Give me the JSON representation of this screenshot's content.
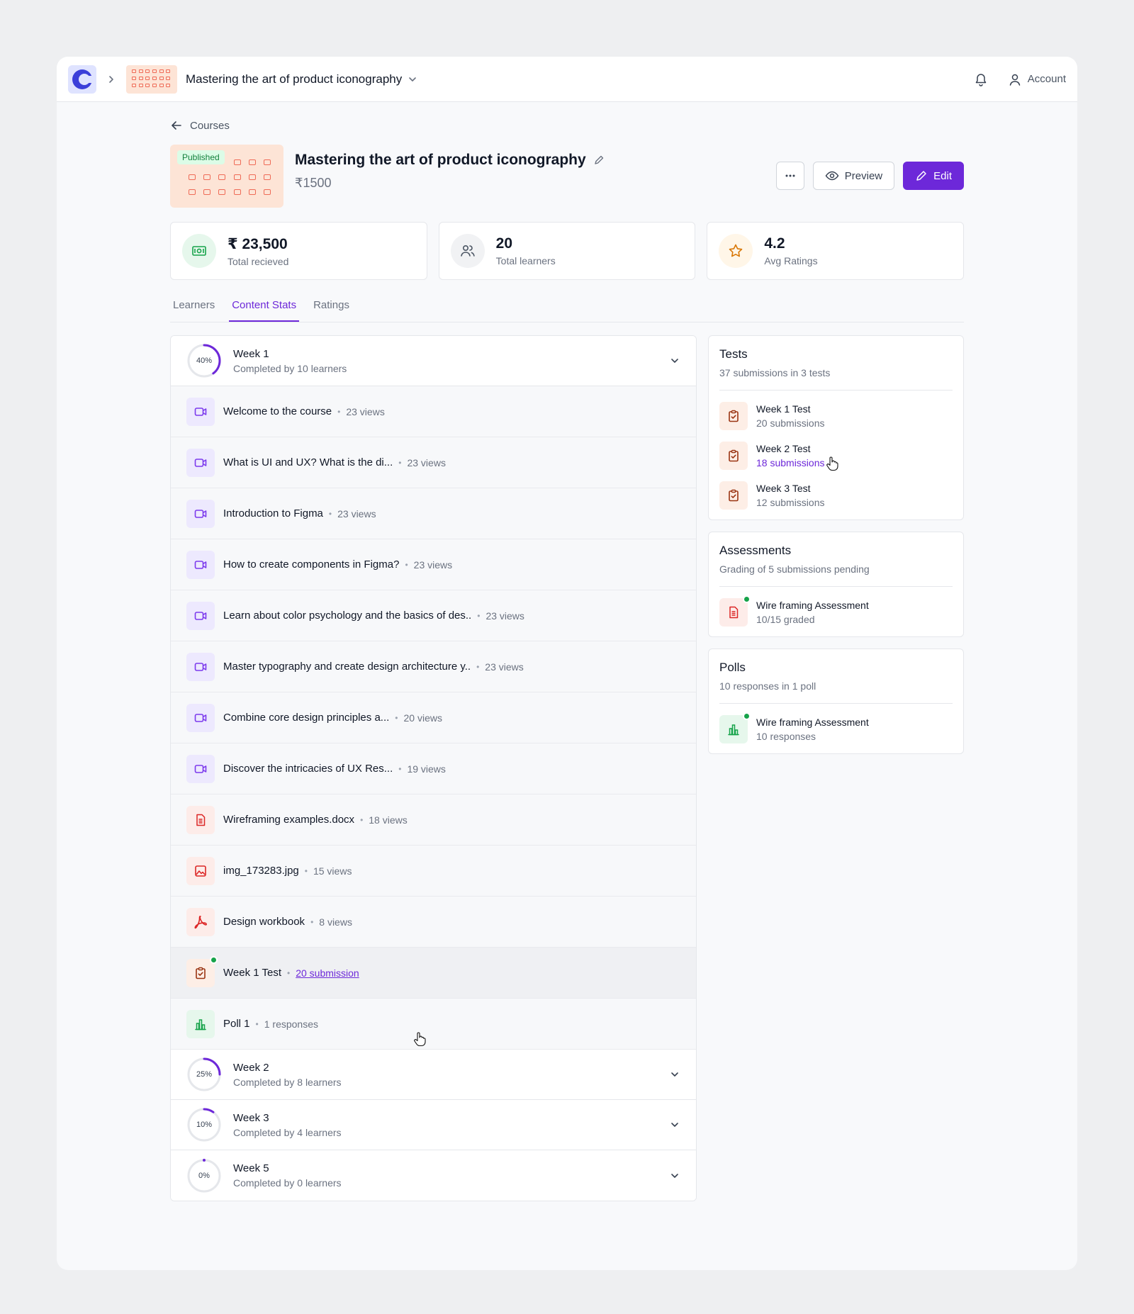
{
  "topbar": {
    "course_title": "Mastering the art of product iconography",
    "account_label": "Account"
  },
  "header": {
    "back_label": "Courses",
    "badge": "Published",
    "title": "Mastering the art of product iconography",
    "price": "₹1500",
    "preview_label": "Preview",
    "edit_label": "Edit"
  },
  "stats": [
    {
      "value": "₹ 23,500",
      "label": "Total recieved",
      "icon": "money-icon",
      "color": "#16a34a"
    },
    {
      "value": "20",
      "label": "Total learners",
      "icon": "users-icon",
      "color": "#4b5563"
    },
    {
      "value": "4.2",
      "label": "Avg Ratings",
      "icon": "star-icon",
      "color": "#d97706"
    }
  ],
  "tabs": [
    "Learners",
    "Content Stats",
    "Ratings"
  ],
  "weeks": [
    {
      "percent_label": "40%",
      "percent": 40,
      "title": "Week 1",
      "subtitle": "Completed by 10 learners"
    },
    {
      "percent_label": "25%",
      "percent": 25,
      "title": "Week 2",
      "subtitle": "Completed by 8 learners"
    },
    {
      "percent_label": "10%",
      "percent": 10,
      "title": "Week 3",
      "subtitle": "Completed by 4 learners"
    },
    {
      "percent_label": "0%",
      "percent": 0,
      "title": "Week 5",
      "subtitle": "Completed by 0 learners"
    }
  ],
  "items": [
    {
      "name": "Welcome to the course",
      "meta": "23 views",
      "icon": "video-icon"
    },
    {
      "name": "What is UI and UX? What is the di...",
      "meta": "23 views",
      "icon": "video-icon"
    },
    {
      "name": "Introduction to Figma",
      "meta": "23 views",
      "icon": "video-icon"
    },
    {
      "name": "How to create components in Figma?",
      "meta": "23 views",
      "icon": "video-icon"
    },
    {
      "name": "Learn about color psychology and the basics of des..",
      "meta": "23 views",
      "icon": "video-icon"
    },
    {
      "name": "Master typography and create design architecture y..",
      "meta": "23 views",
      "icon": "video-icon"
    },
    {
      "name": "Combine core design principles a...",
      "meta": "20 views",
      "icon": "video-icon"
    },
    {
      "name": "Discover the intricacies of UX Res...",
      "meta": "19 views",
      "icon": "video-icon"
    },
    {
      "name": "Wireframing examples.docx",
      "meta": "18 views",
      "icon": "document-icon"
    },
    {
      "name": "img_173283.jpg",
      "meta": "15 views",
      "icon": "image-icon"
    },
    {
      "name": "Design workbook",
      "meta": "8 views",
      "icon": "pdf-icon"
    },
    {
      "name": "Week 1 Test",
      "meta": "20 submission",
      "icon": "clipboard-check-icon"
    },
    {
      "name": "Poll 1",
      "meta": "1 responses",
      "icon": "bar-chart-icon"
    }
  ],
  "tests": {
    "title": "Tests",
    "subtitle": "37 submissions in 3 tests",
    "rows": [
      {
        "title": "Week 1 Test",
        "sub": "20 submissions"
      },
      {
        "title": "Week 2 Test",
        "sub": "18 submissions"
      },
      {
        "title": "Week 3 Test",
        "sub": "12 submissions"
      }
    ]
  },
  "assessments": {
    "title": "Assessments",
    "subtitle": "Grading of 5 submissions pending",
    "rows": [
      {
        "title": "Wire framing Assessment",
        "sub": "10/15 graded"
      }
    ]
  },
  "polls": {
    "title": "Polls",
    "subtitle": "10 responses in 1 poll",
    "rows": [
      {
        "title": "Wire framing Assessment",
        "sub": "10 responses"
      }
    ]
  }
}
